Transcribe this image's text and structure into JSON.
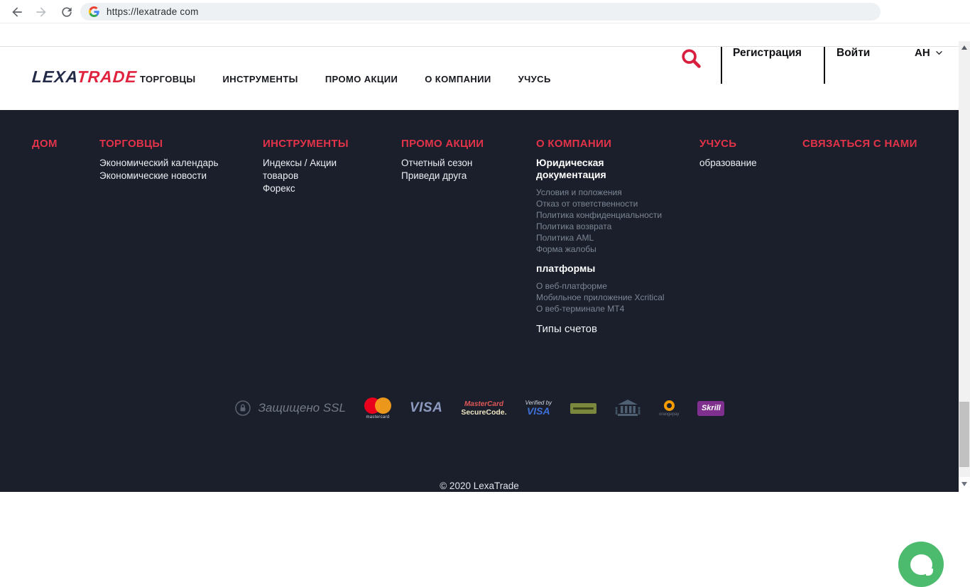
{
  "browser": {
    "url": "https://lexatrade com"
  },
  "header": {
    "logo_part1": "LEXA",
    "logo_part2": "TRADE",
    "nav": [
      "ТОРГОВЦЫ",
      "ИНСТРУМЕНТЫ",
      "ПРОМО АКЦИИ",
      "О КОМПАНИИ",
      "УЧУСЬ"
    ],
    "register_label": "Регистрация",
    "login_label": "Войти",
    "language_label": "АН"
  },
  "footer": {
    "columns": [
      {
        "title": "ДОМ"
      },
      {
        "title": "ТОРГОВЦЫ",
        "links": [
          "Экономический календарь",
          "Экономические новости"
        ]
      },
      {
        "title": "ИНСТРУМЕНТЫ",
        "links": [
          "Индексы / Акции",
          "товаров",
          "Форекс"
        ]
      },
      {
        "title": "ПРОМО АКЦИИ",
        "links": [
          "Отчетный сезон",
          "Приведи друга"
        ]
      },
      {
        "title": "О КОМПАНИИ",
        "subgroups": [
          {
            "heading": "Юридическая документация",
            "links": [
              "Условия и положения",
              "Отказ от ответственности",
              "Политика конфиденциальности",
              "Политика возврата",
              "Политика AML",
              "Форма жалобы"
            ]
          },
          {
            "heading": "платформы",
            "links": [
              "О веб-платформе",
              "Мобильное приложение Xcritical",
              "О веб-терминале МТ4"
            ]
          }
        ],
        "extra": "Типы счетов"
      },
      {
        "title": "УЧУСЬ",
        "links": [
          "образование"
        ]
      },
      {
        "title": "СВЯЗАТЬСЯ С НАМИ"
      }
    ],
    "payments": {
      "ssl_label": "Защищено SSL",
      "mastercard_label": "mastercard",
      "visa_label": "VISA",
      "securecode_line1": "MasterCard",
      "securecode_line2": "SecureCode.",
      "verified_line1": "Verified by",
      "verified_line2": "VISA",
      "orangepay_label": "orangepay",
      "skrill_label": "Skrill"
    },
    "copyright": "© 2020 LexaTrade"
  },
  "colors": {
    "accent_red": "#e23349",
    "logo_navy": "#232a47",
    "logo_red": "#e0243f",
    "footer_bg": "#1a1f2b",
    "chat_green": "#4cbb6e",
    "skrill_purple": "#7f2f8e",
    "muted_link_grey": "#7d8696"
  }
}
